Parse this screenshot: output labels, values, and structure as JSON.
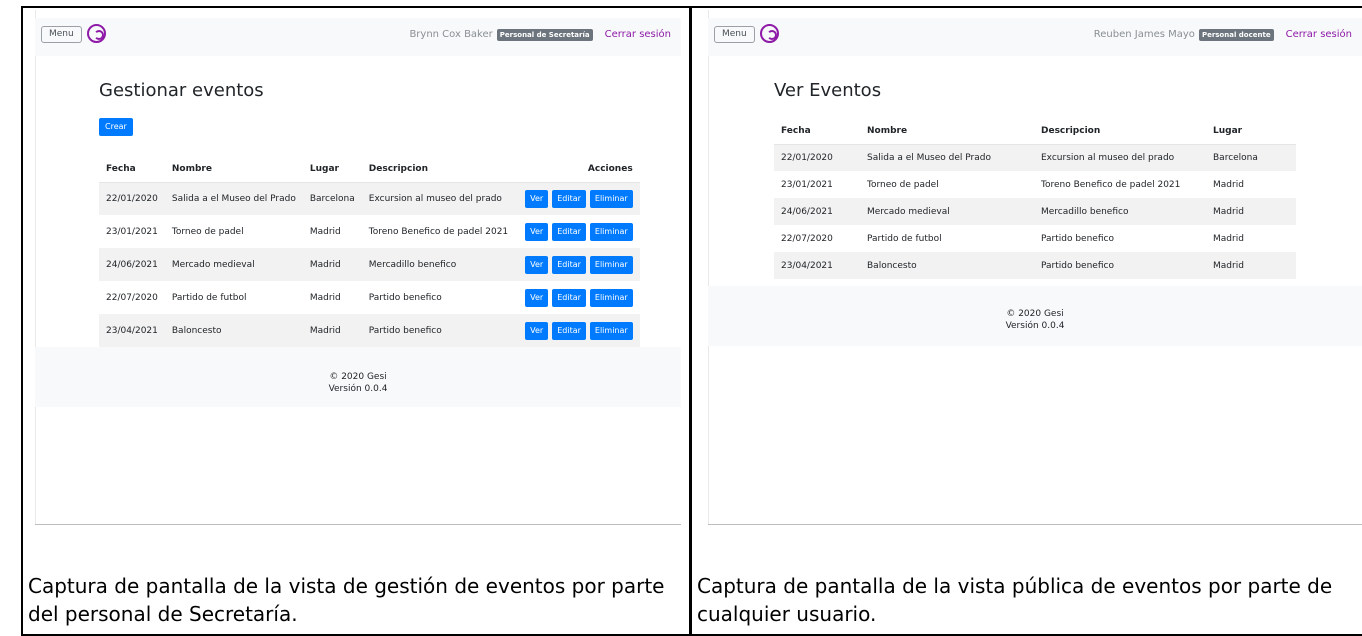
{
  "left": {
    "navbar": {
      "menu_label": "Menu",
      "user_name": "Brynn Cox Baker",
      "role": "Personal de Secretaría",
      "logout": "Cerrar sesión"
    },
    "title": "Gestionar eventos",
    "create_label": "Crear",
    "columns": [
      "Fecha",
      "Nombre",
      "Lugar",
      "Descripcion",
      "Acciones"
    ],
    "rows": [
      {
        "fecha": "22/01/2020",
        "nombre": "Salida a el Museo del Prado",
        "lugar": "Barcelona",
        "descripcion": "Excursion al museo del prado"
      },
      {
        "fecha": "23/01/2021",
        "nombre": "Torneo de padel",
        "lugar": "Madrid",
        "descripcion": "Toreno Benefico de padel 2021"
      },
      {
        "fecha": "24/06/2021",
        "nombre": "Mercado medieval",
        "lugar": "Madrid",
        "descripcion": "Mercadillo benefico"
      },
      {
        "fecha": "22/07/2020",
        "nombre": "Partido de futbol",
        "lugar": "Madrid",
        "descripcion": "Partido benefico"
      },
      {
        "fecha": "23/04/2021",
        "nombre": "Baloncesto",
        "lugar": "Madrid",
        "descripcion": "Partido benefico"
      }
    ],
    "actions": {
      "view": "Ver",
      "edit": "Editar",
      "delete": "Eliminar"
    },
    "footer": {
      "copyright": "© 2020 Gesi",
      "version": "Versión 0.0.4"
    },
    "caption": "Captura de pantalla de la vista de gestión de eventos por parte del personal de Secretaría."
  },
  "right": {
    "navbar": {
      "menu_label": "Menu",
      "user_name": "Reuben James Mayo",
      "role": "Personal docente",
      "logout": "Cerrar sesión"
    },
    "title": "Ver Eventos",
    "columns": [
      "Fecha",
      "Nombre",
      "Descripcion",
      "Lugar"
    ],
    "rows": [
      {
        "fecha": "22/01/2020",
        "nombre": "Salida a el Museo del Prado",
        "descripcion": "Excursion al museo del prado",
        "lugar": "Barcelona"
      },
      {
        "fecha": "23/01/2021",
        "nombre": "Torneo de padel",
        "descripcion": "Toreno Benefico de padel 2021",
        "lugar": "Madrid"
      },
      {
        "fecha": "24/06/2021",
        "nombre": "Mercado medieval",
        "descripcion": "Mercadillo benefico",
        "lugar": "Madrid"
      },
      {
        "fecha": "22/07/2020",
        "nombre": "Partido de futbol",
        "descripcion": "Partido benefico",
        "lugar": "Madrid"
      },
      {
        "fecha": "23/04/2021",
        "nombre": "Baloncesto",
        "descripcion": "Partido benefico",
        "lugar": "Madrid"
      }
    ],
    "footer": {
      "copyright": "© 2020 Gesi",
      "version": "Versión 0.0.4"
    },
    "caption": "Captura de pantalla de la vista pública de eventos por parte de cualquier usuario."
  },
  "colors": {
    "primary": "#007bff",
    "brand": "#8e1aa8",
    "badge": "#6c757d",
    "navbar_bg": "#f8f9fa",
    "stripe": "#f2f2f2"
  },
  "icons": {
    "logo": "gesi-logo-icon"
  }
}
